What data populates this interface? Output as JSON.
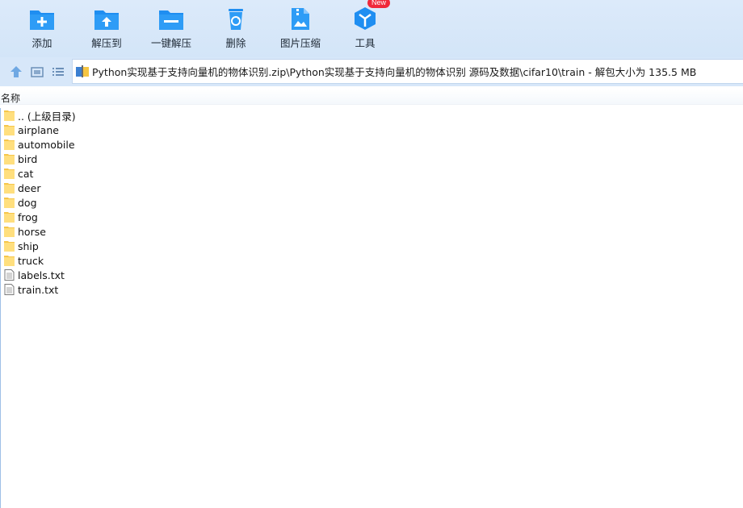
{
  "toolbar": {
    "items": [
      {
        "label": "添加",
        "icon": "add-icon"
      },
      {
        "label": "解压到",
        "icon": "extract-to-icon"
      },
      {
        "label": "一键解压",
        "icon": "one-click-extract-icon"
      },
      {
        "label": "删除",
        "icon": "recycle-icon"
      },
      {
        "label": "图片压缩",
        "icon": "image-compress-icon"
      },
      {
        "label": "工具",
        "icon": "tools-cube-icon"
      }
    ],
    "badge": "New"
  },
  "nav": {
    "path": "Python实现基于支持向量机的物体识别.zip\\Python实现基于支持向量机的物体识别 源码及数据\\cifar10\\train - 解包大小为 135.5 MB"
  },
  "list": {
    "column_name": "名称",
    "items": [
      {
        "name": ".. (上级目录)",
        "type": "folder"
      },
      {
        "name": "airplane",
        "type": "folder"
      },
      {
        "name": "automobile",
        "type": "folder"
      },
      {
        "name": "bird",
        "type": "folder"
      },
      {
        "name": "cat",
        "type": "folder"
      },
      {
        "name": "deer",
        "type": "folder"
      },
      {
        "name": "dog",
        "type": "folder"
      },
      {
        "name": "frog",
        "type": "folder"
      },
      {
        "name": "horse",
        "type": "folder"
      },
      {
        "name": "ship",
        "type": "folder"
      },
      {
        "name": "truck",
        "type": "folder"
      },
      {
        "name": "labels.txt",
        "type": "file"
      },
      {
        "name": "train.txt",
        "type": "file"
      }
    ]
  },
  "colors": {
    "accent": "#1f8ef1",
    "toolbar_bg": "#d7e7f9",
    "folder": "#ffd76a",
    "badge": "#f0283a"
  }
}
